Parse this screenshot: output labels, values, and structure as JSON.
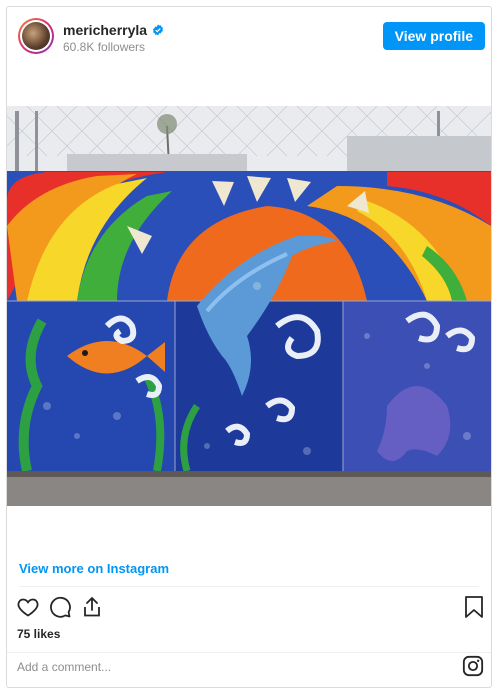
{
  "header": {
    "username": "mericherryla",
    "followers": "60.8K followers",
    "view_profile": "View profile"
  },
  "post": {
    "image_alt": "Colorful bottle-cap mosaic mural",
    "view_more": "View more on Instagram",
    "likes": "75 likes",
    "comment_placeholder": "Add a comment..."
  },
  "colors": {
    "accent": "#0095f6",
    "text": "#262626",
    "muted": "#8e8e8e"
  },
  "icons": [
    "verified-badge-icon",
    "heart-icon",
    "comment-icon",
    "share-icon",
    "bookmark-icon",
    "instagram-logo-icon"
  ]
}
